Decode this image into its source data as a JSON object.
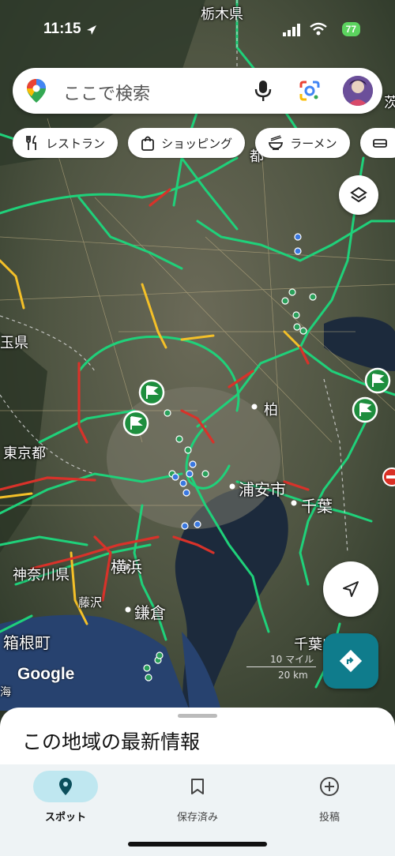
{
  "status": {
    "time": "11:15",
    "battery": "77"
  },
  "search": {
    "placeholder": "ここで検索"
  },
  "chips": [
    {
      "label": "レストラン",
      "icon": "restaurant-icon"
    },
    {
      "label": "ショッピング",
      "icon": "shopping-bag-icon"
    },
    {
      "label": "ラーメン",
      "icon": "ramen-bowl-icon"
    }
  ],
  "map": {
    "labels": {
      "tochigi": "栃木県",
      "saitama": "玉県",
      "tokyo": "東京都",
      "kanagawa": "神奈川県",
      "yokohama": "横浜",
      "kamakura": "鎌倉",
      "fujisawa": "藤沢",
      "hakone": "箱根町",
      "kashiwa": "柏",
      "urayasu": "浦安市",
      "chiba": "千葉",
      "chiba_pref": "千葉県",
      "ibaraki": "茨",
      "to": "都",
      "umi": "海"
    },
    "scale": {
      "miles": "10 マイル",
      "km": "20 km"
    },
    "logo": "Google",
    "colors": {
      "traffic_green": "#1fd17a",
      "traffic_yellow": "#f4c028",
      "traffic_red": "#d8322a",
      "water": "#1c2a3c"
    }
  },
  "sheet": {
    "title": "この地域の最新情報"
  },
  "tabs": [
    {
      "label": "スポット",
      "icon": "place-pin-icon",
      "active": true
    },
    {
      "label": "保存済み",
      "icon": "bookmark-icon",
      "active": false
    },
    {
      "label": "投稿",
      "icon": "add-circle-icon",
      "active": false
    }
  ]
}
